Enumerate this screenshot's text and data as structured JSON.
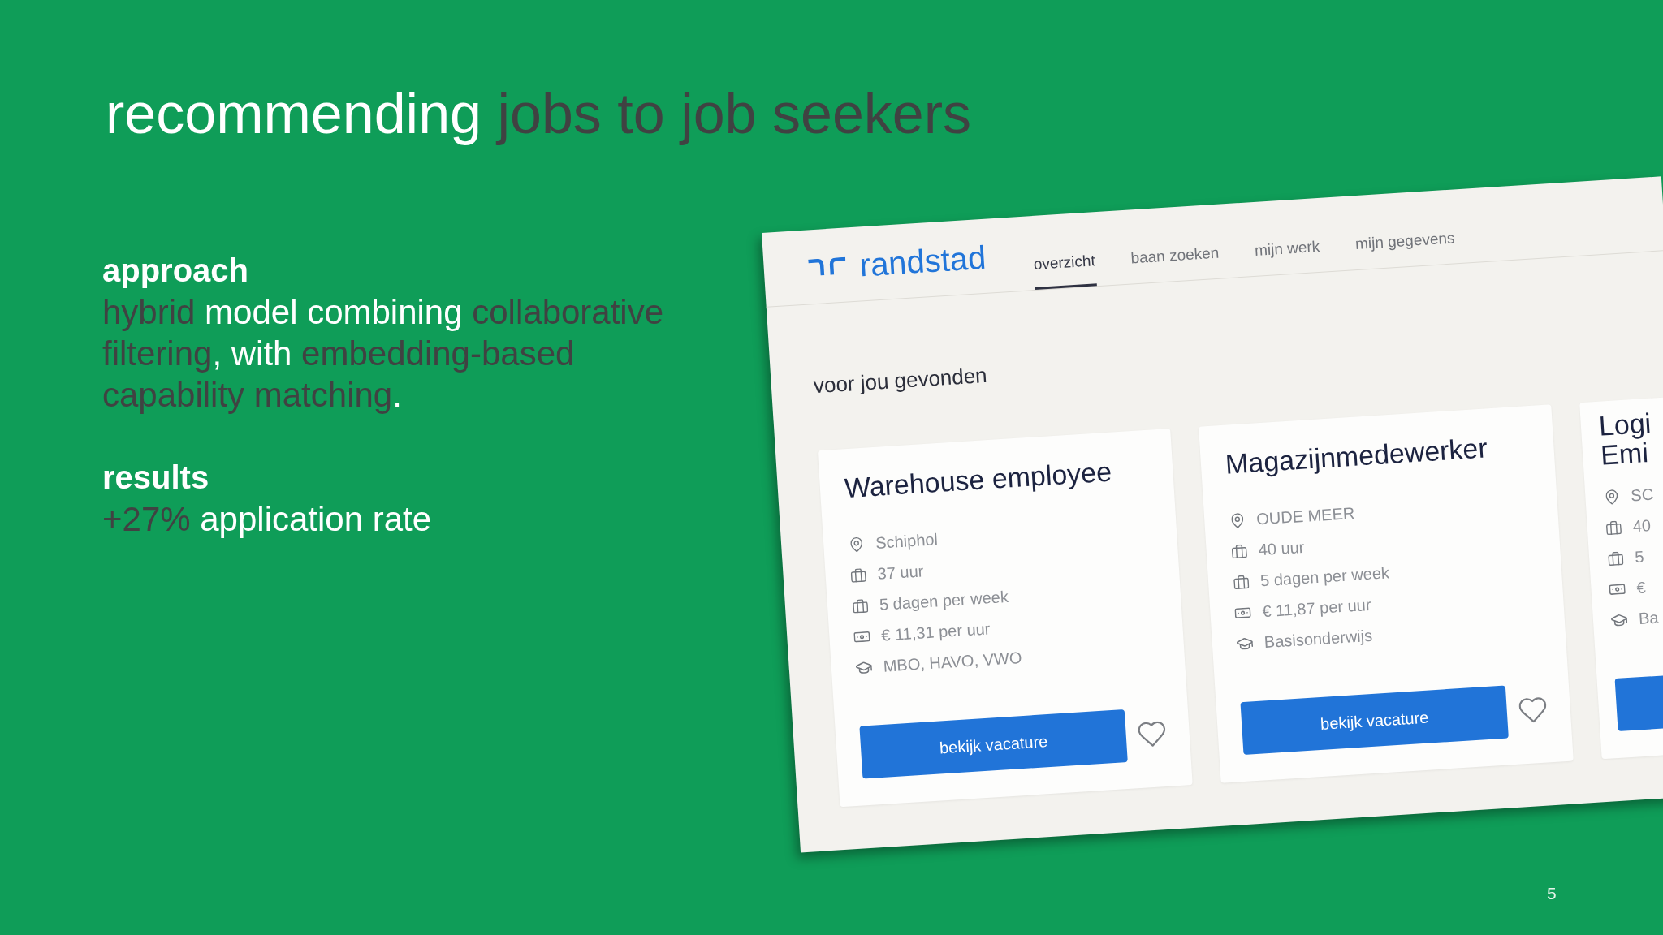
{
  "title": [
    {
      "text": "recommending ",
      "emphasis": false
    },
    {
      "text": "jobs to job seekers",
      "emphasis": true
    }
  ],
  "sections": [
    {
      "heading": "approach",
      "body": [
        {
          "text": "hybrid",
          "emphasis": true
        },
        {
          "text": " model combining ",
          "emphasis": false
        },
        {
          "text": "collaborative filtering",
          "emphasis": true
        },
        {
          "text": ", with ",
          "emphasis": false
        },
        {
          "text": "embedding-based capability matching",
          "emphasis": true
        },
        {
          "text": ".",
          "emphasis": false
        }
      ]
    },
    {
      "heading": "results",
      "body": [
        {
          "text": "+27%",
          "emphasis": true
        },
        {
          "text": " application rate",
          "emphasis": false
        }
      ]
    }
  ],
  "app": {
    "brand": "randstad",
    "tabs": [
      {
        "label": "overzicht",
        "selected": true
      },
      {
        "label": "baan zoeken",
        "selected": false
      },
      {
        "label": "mijn werk",
        "selected": false
      },
      {
        "label": "mijn gegevens",
        "selected": false
      }
    ],
    "section_title": "voor jou gevonden",
    "jobs": [
      {
        "title": "Warehouse employee",
        "details": [
          {
            "kind": "location",
            "text": "Schiphol"
          },
          {
            "kind": "hours",
            "text": "37 uur"
          },
          {
            "kind": "days",
            "text": "5 dagen per week"
          },
          {
            "kind": "pay",
            "text": "€ 11,31 per uur"
          },
          {
            "kind": "education",
            "text": "MBO, HAVO, VWO"
          }
        ],
        "button": "bekijk vacature",
        "favorited": false
      },
      {
        "title": "Magazijnmedewerker",
        "details": [
          {
            "kind": "location",
            "text": "OUDE MEER"
          },
          {
            "kind": "hours",
            "text": "40 uur"
          },
          {
            "kind": "days",
            "text": "5 dagen per week"
          },
          {
            "kind": "pay",
            "text": "€ 11,87 per uur"
          },
          {
            "kind": "education",
            "text": "Basisonderwijs"
          }
        ],
        "button": "bekijk vacature",
        "favorited": false
      },
      {
        "title": "Logi Emi",
        "details": [
          {
            "kind": "location",
            "text": "SC"
          },
          {
            "kind": "hours",
            "text": "40"
          },
          {
            "kind": "days",
            "text": "5"
          },
          {
            "kind": "pay",
            "text": "€"
          },
          {
            "kind": "education",
            "text": "Ba"
          }
        ]
      }
    ]
  },
  "page_number": "5"
}
